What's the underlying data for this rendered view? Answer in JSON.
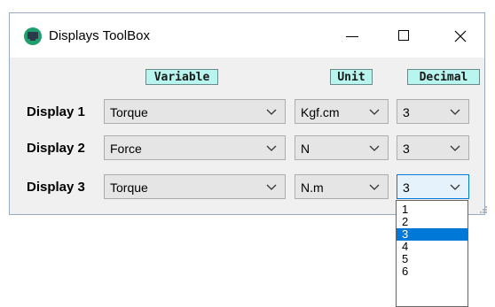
{
  "window": {
    "title": "Displays ToolBox"
  },
  "headers": {
    "variable": "Variable",
    "unit": "Unit",
    "decimal": "Decimal"
  },
  "rows": [
    {
      "label": "Display 1",
      "variable": "Torque",
      "unit": "Kgf.cm",
      "decimal": "3"
    },
    {
      "label": "Display 2",
      "variable": "Force",
      "unit": "N",
      "decimal": "3"
    },
    {
      "label": "Display 3",
      "variable": "Torque",
      "unit": "N.m",
      "decimal": "3"
    }
  ],
  "decimal_dropdown": {
    "options": [
      "1",
      "2",
      "3",
      "4",
      "5",
      "6"
    ],
    "selected": "3"
  },
  "colors": {
    "header_bg": "#b8f5ee",
    "selection": "#0078d7",
    "focus_border": "#0078d7"
  }
}
